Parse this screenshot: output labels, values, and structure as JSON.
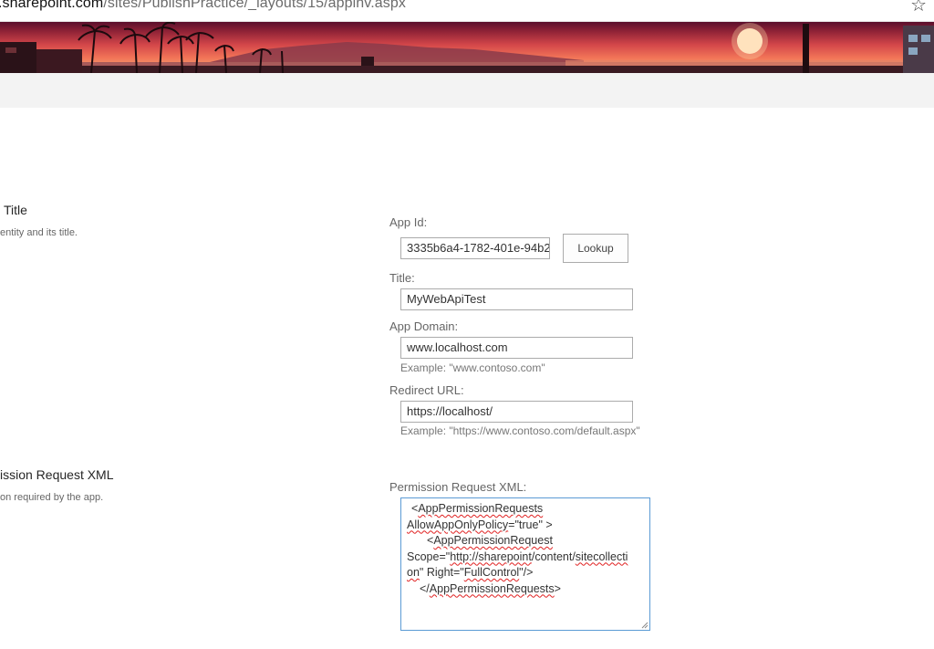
{
  "browser": {
    "url_host": ".sharepoint.com",
    "url_path": "/sites/PublishPractice/_layouts/15/appinv.aspx"
  },
  "colors": {
    "banner_sky_top": "#5a0f2c",
    "banner_sky_mid": "#d4474a",
    "banner_sky_low": "#f17457",
    "suite_bar": "#f3f3f3",
    "focus_border": "#5b9bd5",
    "spell_error": "#e02020"
  },
  "sections": {
    "id_title": {
      "heading": "Title",
      "description": "entity and its title."
    },
    "permission": {
      "heading": "ission Request XML",
      "description": "on required by the app."
    }
  },
  "form": {
    "app_id": {
      "label": "App Id:",
      "value": "3335b6a4-1782-401e-94b2"
    },
    "lookup_button": "Lookup",
    "title": {
      "label": "Title:",
      "value": "MyWebApiTest"
    },
    "app_domain": {
      "label": "App Domain:",
      "value": "www.localhost.com",
      "example": "Example: \"www.contoso.com\""
    },
    "redirect_url": {
      "label": "Redirect URL:",
      "value": "https://localhost/",
      "example": "Example: \"https://www.contoso.com/default.aspx\""
    },
    "permission_xml": {
      "label": "Permission Request XML:",
      "l1a": "<",
      "l1b": "AppPermissionRequests",
      "l2a": "AllowAppOnlyPolicy",
      "l2b": "=\"true\" >",
      "l3a": "<",
      "l3b": "AppPermissionRequest",
      "l4a": "Scope=\"",
      "l4b": "http://sharepoint",
      "l4c": "/content/",
      "l4d": "sitecollecti",
      "l5a": "on",
      "l5b": "\" Right=\"",
      "l5c": "FullControl",
      "l5d": "\"/>",
      "l6a": "</",
      "l6b": "AppPermissionRequests",
      "l6c": ">"
    }
  },
  "icons": {
    "bookmark": "star-outline-icon",
    "resize": "resize-grip-icon"
  }
}
